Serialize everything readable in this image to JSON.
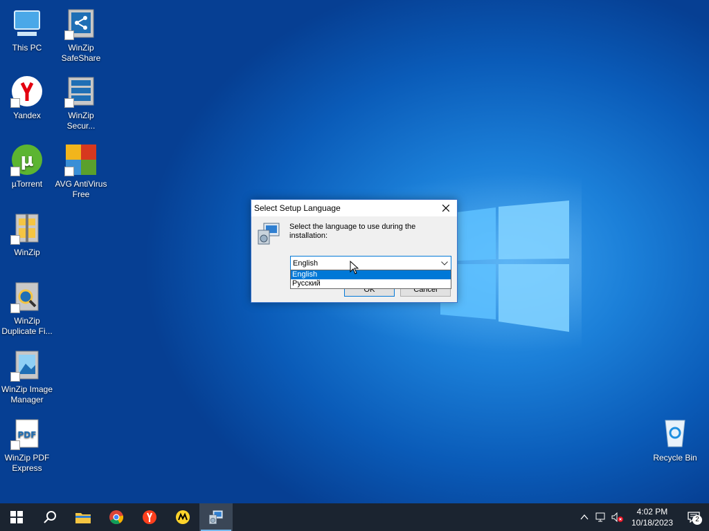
{
  "desktop": {
    "icons": [
      {
        "label": "This PC",
        "icon": "computer-icon"
      },
      {
        "label": "WinZip SafeShare",
        "icon": "winzip-safeshare-icon"
      },
      {
        "label": "Yandex",
        "icon": "yandex-browser-icon"
      },
      {
        "label": "WinZip Secur...",
        "icon": "winzip-secure-backup-icon"
      },
      {
        "label": "µTorrent",
        "icon": "utorrent-icon"
      },
      {
        "label": "AVG AntiVirus Free",
        "icon": "avg-antivirus-icon"
      },
      {
        "label": "WinZip",
        "icon": "winzip-icon"
      },
      {
        "label": "WinZip Duplicate Fi...",
        "icon": "winzip-duplicate-finder-icon"
      },
      {
        "label": "WinZip Image Manager",
        "icon": "winzip-image-manager-icon"
      },
      {
        "label": "WinZip PDF Express",
        "icon": "winzip-pdf-express-icon"
      }
    ],
    "recycle_bin": {
      "label": "Recycle Bin",
      "icon": "recycle-bin-icon"
    }
  },
  "dialog": {
    "title": "Select Setup Language",
    "prompt": "Select the language to use during the installation:",
    "selected": "English",
    "options": [
      "English",
      "Русский"
    ],
    "ok_label": "OK",
    "cancel_label": "Cancel"
  },
  "taskbar": {
    "apps": [
      "start-icon",
      "search-icon",
      "file-explorer-icon",
      "chrome-icon",
      "yandex-icon",
      "yandex-market-icon",
      "setup-installer-icon"
    ],
    "time": "4:02 PM",
    "date": "10/18/2023",
    "notification_count": "2"
  },
  "colors": {
    "accent": "#0078d7",
    "taskbar": "#1b2430",
    "desktop": "#0a5bb8"
  }
}
